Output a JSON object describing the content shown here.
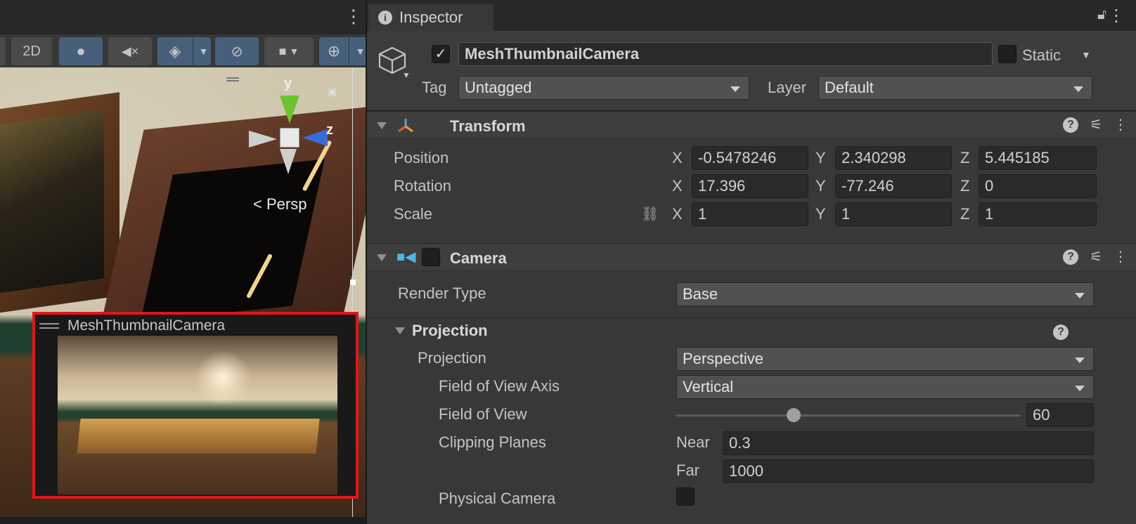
{
  "scene": {
    "toolbar": {
      "btn_2d": "2D"
    },
    "gizmo": {
      "axis_y": "y",
      "axis_z": "z",
      "projection": "< Persp"
    },
    "camera_preview": {
      "title": "MeshThumbnailCamera"
    }
  },
  "inspector": {
    "tab_label": "Inspector",
    "gameobject": {
      "active": true,
      "name": "MeshThumbnailCamera",
      "static_label": "Static",
      "static": false,
      "tag_label": "Tag",
      "tag_value": "Untagged",
      "layer_label": "Layer",
      "layer_value": "Default"
    },
    "transform": {
      "title": "Transform",
      "position_label": "Position",
      "rotation_label": "Rotation",
      "scale_label": "Scale",
      "axis_x": "X",
      "axis_y": "Y",
      "axis_z": "Z",
      "position": {
        "x": "-0.5478246",
        "y": "2.340298",
        "z": "5.445185"
      },
      "rotation": {
        "x": "17.396",
        "y": "-77.246",
        "z": "0"
      },
      "scale": {
        "x": "1",
        "y": "1",
        "z": "1"
      }
    },
    "camera": {
      "title": "Camera",
      "enabled": false,
      "render_type_label": "Render Type",
      "render_type_value": "Base",
      "projection_section": "Projection",
      "projection_label": "Projection",
      "projection_value": "Perspective",
      "fov_axis_label": "Field of View Axis",
      "fov_axis_value": "Vertical",
      "fov_label": "Field of View",
      "fov_value": "60",
      "fov_slider_fraction": 0.34,
      "clipping_label": "Clipping Planes",
      "near_label": "Near",
      "near_value": "0.3",
      "far_label": "Far",
      "far_value": "1000",
      "physical_label": "Physical Camera",
      "physical": false
    }
  },
  "colors": {
    "selection_border": "#e0161b",
    "toggle_on": "#46607c",
    "panel_bg": "#383838"
  }
}
